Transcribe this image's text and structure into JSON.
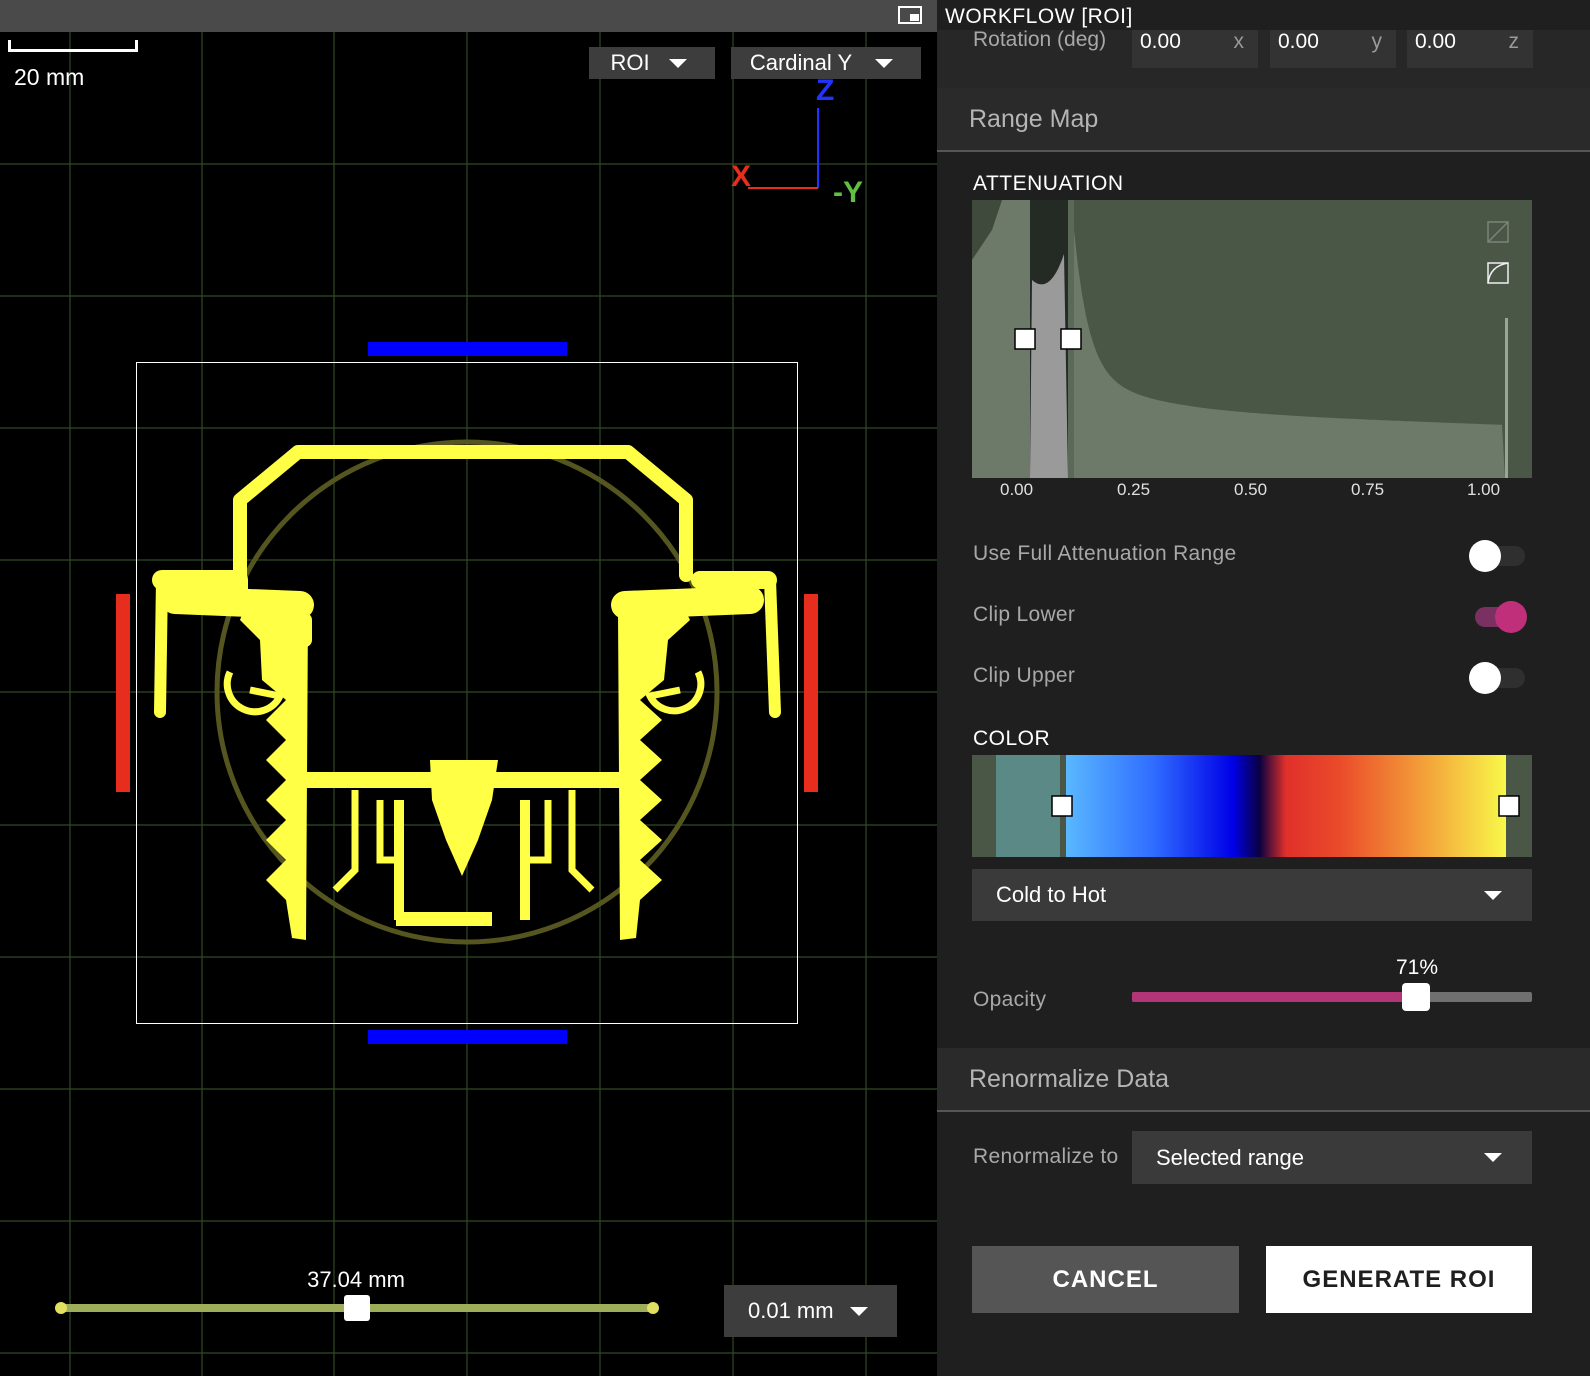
{
  "viewport": {
    "scale_label": "20 mm",
    "view_dropdown": "ROI",
    "orientation_dropdown": "Cardinal Y",
    "axes": {
      "z": "Z",
      "x": "X",
      "y": "-Y"
    },
    "slice_position": "37.04 mm",
    "slice_fraction": 0.5,
    "step_dropdown": "0.01 mm",
    "colors": {
      "roi_blue": "#0000ff",
      "roi_red": "#e62d1e",
      "part": "#ffff45",
      "slider": "#9dad5a"
    }
  },
  "panel": {
    "title": "WORKFLOW [ROI]",
    "rotation": {
      "label": "Rotation (deg)",
      "x": "0.00",
      "y": "0.00",
      "z": "0.00",
      "x_unit": "x",
      "y_unit": "y",
      "z_unit": "z"
    },
    "range_map": {
      "title": "Range Map",
      "attenuation_label": "ATTENUATION",
      "ticks": [
        "0.00",
        "0.25",
        "0.50",
        "0.75",
        "1.00"
      ],
      "histogram_icons": [
        "linear-scale-icon",
        "log-scale-icon"
      ],
      "toggles": [
        {
          "label": "Use Full Attenuation Range",
          "on": false
        },
        {
          "label": "Clip Lower",
          "on": true
        },
        {
          "label": "Clip Upper",
          "on": false
        }
      ],
      "color_label": "COLOR",
      "colormap": "Cold to Hot",
      "opacity_label": "Opacity",
      "opacity_value": "71%",
      "opacity_fraction": 0.71
    },
    "renormalize": {
      "title": "Renormalize Data",
      "label": "Renormalize to",
      "value": "Selected range"
    },
    "buttons": {
      "cancel": "CANCEL",
      "generate": "GENERATE ROI"
    }
  }
}
